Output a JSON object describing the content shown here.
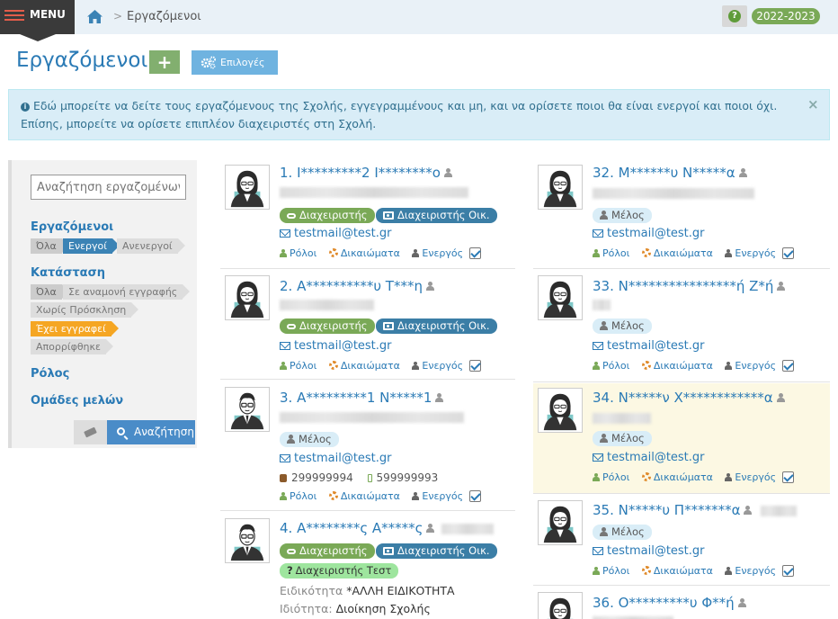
{
  "topbar": {
    "menu_label": "MENU",
    "breadcrumb": "Εργαζόμενοι",
    "breadcrumb_sep": ">",
    "help_icon": "?",
    "school_year": "2022-2023"
  },
  "header": {
    "title": "Εργαζόμενοι",
    "add_label": "+",
    "options_label": "Επιλογές"
  },
  "alert": {
    "text": "Εδώ μπορείτε να δείτε τους εργαζόμενους της Σχολής, εγγεγραμμένους και μη, και να ορίσετε ποιοι θα είναι ενεργοί και ποιοι όχι. Επίσης, μπορείτε να ορίσετε επιπλέον διαχειριστές στη Σχολή.",
    "close": "×"
  },
  "sidebar": {
    "search_placeholder": "Αναζήτηση εργαζομένων",
    "employees_title": "Εργαζόμενοι",
    "employees_filters": [
      "Όλα",
      "Ενεργοί",
      "Ανενεργοί"
    ],
    "status_title": "Κατάσταση",
    "status_filters": [
      "Όλα",
      "Σε αναμονή εγγραφής",
      "Χωρίς Πρόσκληση",
      "Έχει εγγραφεί",
      "Απορρίφθηκε"
    ],
    "role_title": "Ρόλος",
    "groups_title": "Ομάδες μελών",
    "search_button": "Αναζήτηση"
  },
  "labels": {
    "roles": "Ρόλοι",
    "permissions": "Δικαιώματα",
    "active": "Ενεργός",
    "admin": "Διαχειριστής",
    "school_admin": "Διαχειριστής Οικ.",
    "member": "Μέλος",
    "test_admin": "Διαχειριστής Τεστ",
    "specialty_label": "Ειδικότητα",
    "property_label": "Ιδιότητα:"
  },
  "employees": [
    {
      "name": "1. Ι*********2 Ι********ο",
      "email": "testmail@test.gr",
      "gender": "female"
    },
    {
      "name": "2. Α**********υ Τ***η",
      "email": "testmail@test.gr",
      "gender": "female"
    },
    {
      "name": "3. Α*********1 Ν*****1",
      "email": "testmail@test.gr",
      "phone": "299999994",
      "mobile": "599999993",
      "gender": "male"
    },
    {
      "name": "4. Α********ς Α*****ς",
      "specialty": "*ΑΛΛΗ ΕΙΔΙΚΟΤΗΤΑ",
      "property": "Διοίκηση Σχολής",
      "gender": "male"
    },
    {
      "name": "32. Μ******υ Ν*****α",
      "email": "testmail@test.gr",
      "gender": "female"
    },
    {
      "name": "33. Ν****************ή Ζ*ή",
      "email": "testmail@test.gr",
      "gender": "female"
    },
    {
      "name": "34. Ν*****ν Χ************α",
      "email": "testmail@test.gr",
      "gender": "female"
    },
    {
      "name": "35. Ν*****υ Π*******α",
      "email": "testmail@test.gr",
      "gender": "female"
    },
    {
      "name": "36. Ο*********υ Φ**ή",
      "gender": "female"
    }
  ]
}
